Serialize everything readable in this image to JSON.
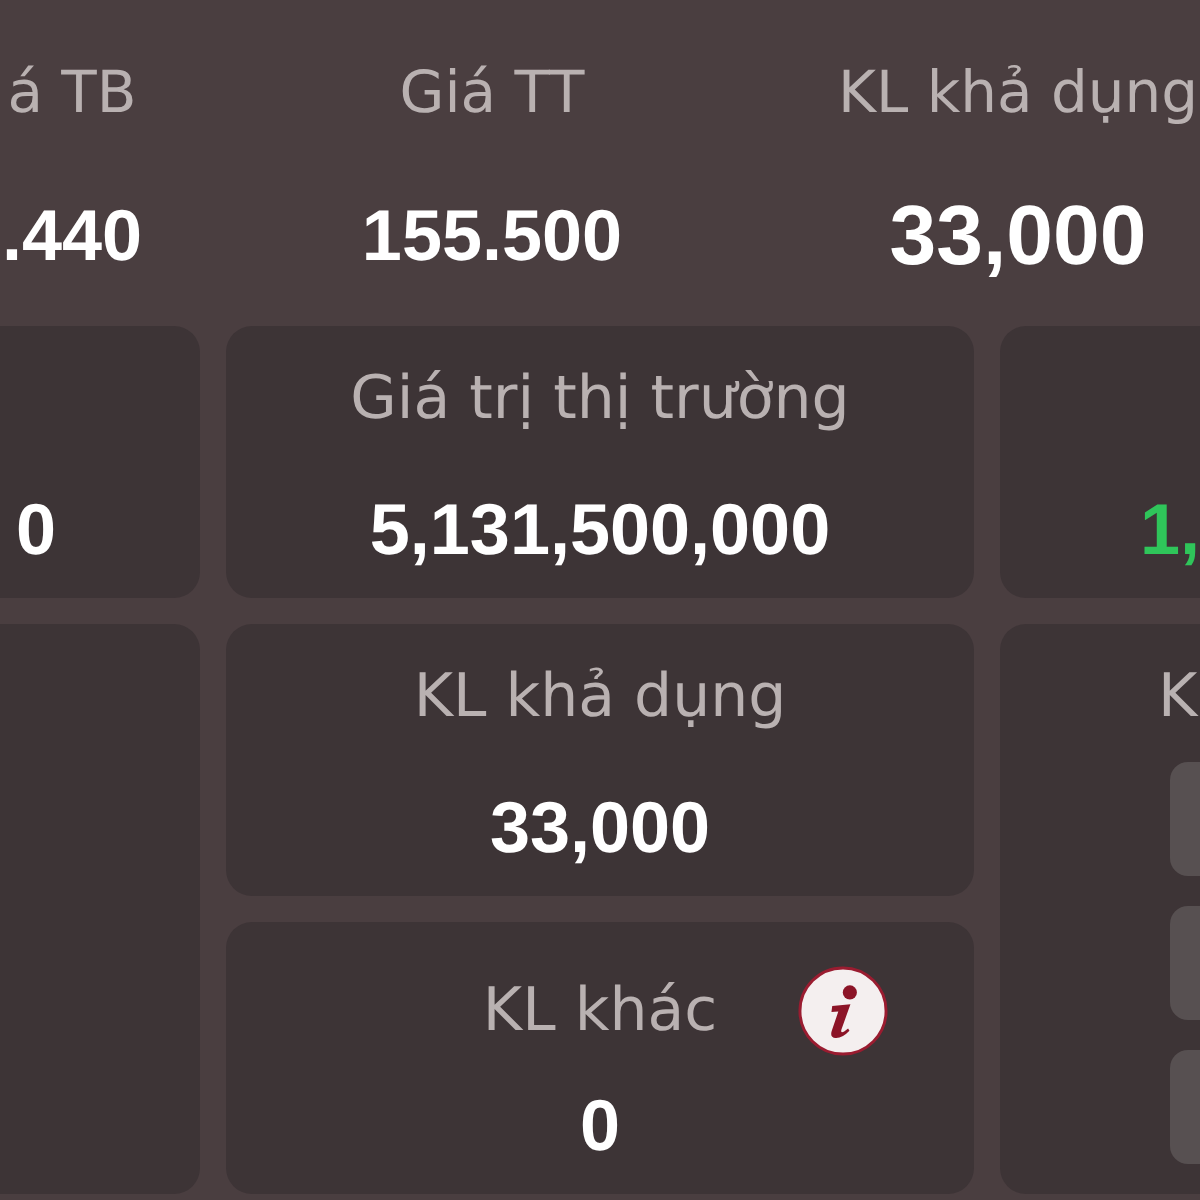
{
  "summary": [
    {
      "label": "á TB",
      "value": ".440",
      "emphasized": false
    },
    {
      "label": "Giá TT",
      "value": "155.500",
      "emphasized": false
    },
    {
      "label": "KL khả dụng",
      "value": "33,000",
      "emphasized": true
    }
  ],
  "columns": [
    {
      "cards": [
        {
          "kind": "stat",
          "value": "0",
          "positive": false,
          "info": false
        },
        {
          "kind": "blank"
        }
      ]
    },
    {
      "cards": [
        {
          "kind": "stat",
          "label": "Giá trị thị trường",
          "value": "5,131,500,000",
          "positive": false,
          "info": false
        },
        {
          "kind": "stat",
          "label": "KL khả dụng",
          "value": "33,000",
          "positive": false,
          "info": false
        },
        {
          "kind": "stat",
          "label": "KL khác",
          "value": "0",
          "positive": false,
          "info": true
        }
      ]
    },
    {
      "cards": [
        {
          "kind": "stat",
          "value": "1,",
          "positive": true,
          "info": false
        },
        {
          "kind": "options",
          "label": "K"
        }
      ]
    }
  ]
}
